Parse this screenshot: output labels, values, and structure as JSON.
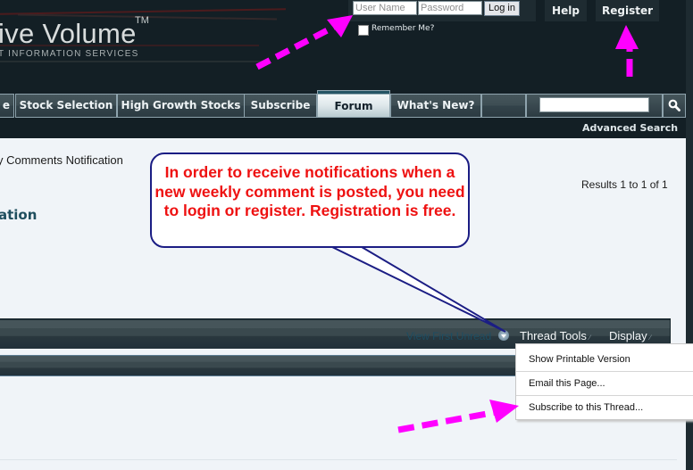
{
  "header": {
    "logo_title": "ive Volume",
    "logo_trademark": "TM",
    "logo_subtitle": "T INFORMATION SERVICES",
    "login": {
      "username_placeholder": "User Name",
      "password_placeholder": "Password",
      "login_button": "Log in",
      "remember_me_label": "Remember Me?",
      "remember_me_checked": false
    },
    "help_link": "Help",
    "register_link": "Register"
  },
  "nav": {
    "tabs": [
      {
        "label": "e",
        "active": false
      },
      {
        "label": "Stock Selection",
        "active": false
      },
      {
        "label": "High Growth Stocks",
        "active": false
      },
      {
        "label": "Subscribe",
        "active": false
      },
      {
        "label": "Forum",
        "active": true
      },
      {
        "label": "What's New?",
        "active": false
      }
    ],
    "search_value": "",
    "search_icon": "magnifier-icon",
    "advanced_search": "Advanced Search"
  },
  "content": {
    "breadcrumb_current": "y Comments Notification",
    "thread_title": "ation",
    "results_text": "Results 1 to 1 of 1",
    "thread_bar": {
      "view_first_unread": "View First Unread",
      "thread_tools": "Thread Tools",
      "display": "Display"
    },
    "thread_tools_menu": [
      "Show Printable Version",
      "Email this Page...",
      "Subscribe to this Thread..."
    ]
  },
  "annotation": {
    "callout_text": "In order to receive notifications when a new weekly comment is posted, you need to login or register. Registration is free.",
    "arrow_color": "#ff00ff",
    "callout_text_color": "#ee1111",
    "callout_border_color": "#1b1d84"
  }
}
